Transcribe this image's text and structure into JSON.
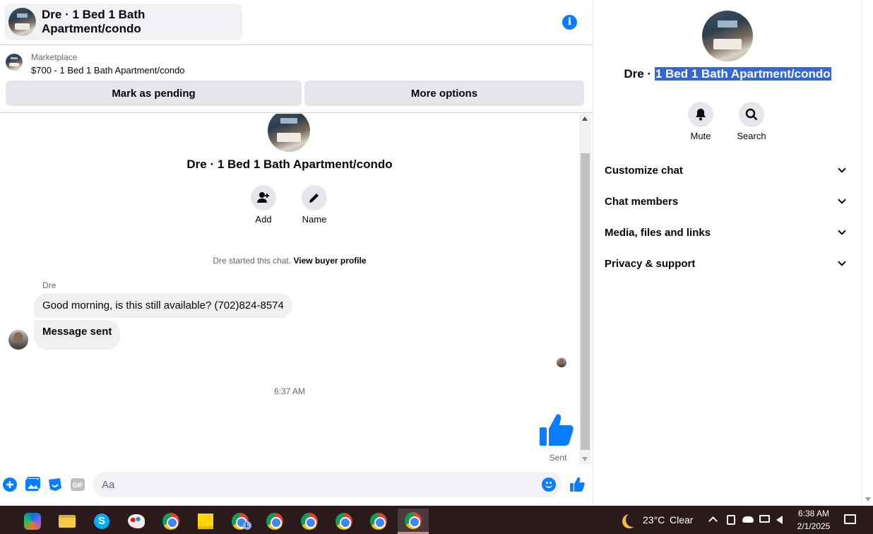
{
  "header": {
    "title": "Dre · 1 Bed 1 Bath Apartment/condo",
    "info_icon": "info-icon",
    "info_glyph": "i"
  },
  "marketplace": {
    "label": "Marketplace",
    "item": "$700 - 1 Bed 1 Bath Apartment/condo",
    "mark_pending_label": "Mark as pending",
    "more_options_label": "More options"
  },
  "chat": {
    "title": "Dre · 1 Bed 1 Bath Apartment/condo",
    "actions": [
      {
        "label": "Add",
        "icon": "add-person-icon"
      },
      {
        "label": "Name",
        "icon": "pencil-icon"
      }
    ],
    "started_text": "Dre started this chat.",
    "buyer_profile_link": "View buyer profile",
    "sender_name": "Dre",
    "messages": [
      {
        "from": "Dre",
        "text": "Good morning, is this still available? (702)824-8574"
      },
      {
        "from": "Dre",
        "text": "Message sent"
      }
    ],
    "timestamp": "6:37 AM",
    "sent_label": "Sent"
  },
  "composer": {
    "placeholder": "Aa",
    "icons": [
      "plus-icon",
      "photo-icon",
      "sticker-icon",
      "gif-icon",
      "emoji-icon",
      "like-icon"
    ],
    "gif_text": "GIF"
  },
  "right_panel": {
    "title_prefix": "Dre · ",
    "title_selected": "1 Bed 1 Bath Apartment/condo",
    "actions": [
      {
        "label": "Mute",
        "icon": "bell-icon"
      },
      {
        "label": "Search",
        "icon": "search-icon"
      }
    ],
    "sections": [
      {
        "label": "Customize chat"
      },
      {
        "label": "Chat members"
      },
      {
        "label": "Media, files and links"
      },
      {
        "label": "Privacy & support"
      }
    ]
  },
  "taskbar": {
    "weather_temp": "23°C",
    "weather_text": "Clear",
    "time": "6:38 AM",
    "date": "2/1/2025",
    "skype_letter": "S",
    "profile_letter": "L"
  },
  "colors": {
    "accent": "#0a7cff",
    "selection": "#3367d6",
    "bubble": "#f0f0f0",
    "button_gray": "#e4e6eb",
    "taskbar": "#2a1a1c"
  }
}
